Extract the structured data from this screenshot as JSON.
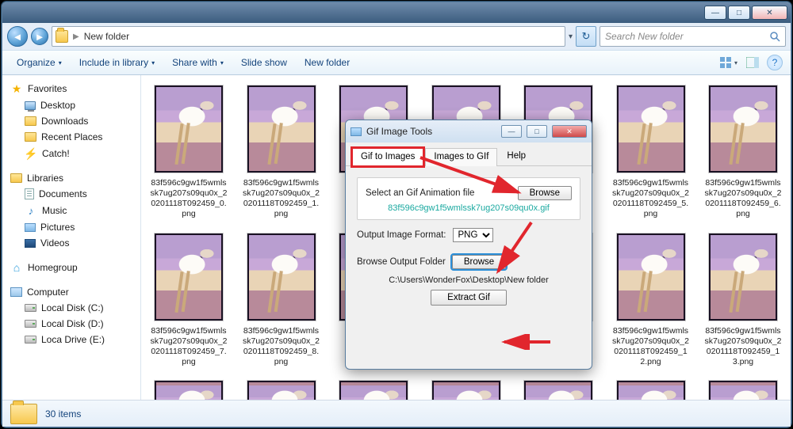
{
  "explorer": {
    "address_label": "New folder",
    "search_placeholder": "Search New folder",
    "toolbar": {
      "organize": "Organize",
      "include": "Include in library",
      "share": "Share with",
      "slideshow": "Slide show",
      "newfolder": "New folder"
    },
    "status_count": "30 items"
  },
  "sidebar": {
    "favorites": "Favorites",
    "desktop": "Desktop",
    "downloads": "Downloads",
    "recent": "Recent Places",
    "catch": "Catch!",
    "libraries": "Libraries",
    "documents": "Documents",
    "music": "Music",
    "pictures": "Pictures",
    "videos": "Videos",
    "homegroup": "Homegroup",
    "computer": "Computer",
    "drive_c": "Local Disk (C:)",
    "drive_d": "Local Disk (D:)",
    "drive_e": "Loca Drive (E:)"
  },
  "files": [
    "83f596c9gw1f5wmlssk7ug207s09qu0x_20201118T092459_0.png",
    "83f596c9gw1f5wmlssk7ug207s09qu0x_20201118T092459_1.png",
    "",
    "",
    "",
    "83f596c9gw1f5wmlssk7ug207s09qu0x_20201118T092459_5.png",
    "83f596c9gw1f5wmlssk7ug207s09qu0x_20201118T092459_6.png",
    "83f596c9gw1f5wmlssk7ug207s09qu0x_20201118T092459_7.png",
    "83f596c9gw1f5wmlssk7ug207s09qu0x_20201118T092459_8.png",
    "",
    "",
    "",
    "83f596c9gw1f5wmlssk7ug207s09qu0x_20201118T092459_12.png",
    "83f596c9gw1f5wmlssk7ug207s09qu0x_20201118T092459_13.png"
  ],
  "dialog": {
    "title": "Gif Image Tools",
    "tab_gif2img": "Gif to Images",
    "tab_img2gif": "Images to GIf",
    "tab_help": "Help",
    "select_label": "Select an Gif Animation file",
    "browse1": "Browse",
    "selected_file": "83f596c9gw1f5wmlssk7ug207s09qu0x.gif",
    "fmt_label": "Output Image Format:",
    "fmt_value": "PNG",
    "outfolder_label": "Browse Output Folder",
    "browse2": "Browse",
    "out_path": "C:\\Users\\WonderFox\\Desktop\\New folder",
    "extract": "Extract Gif"
  }
}
